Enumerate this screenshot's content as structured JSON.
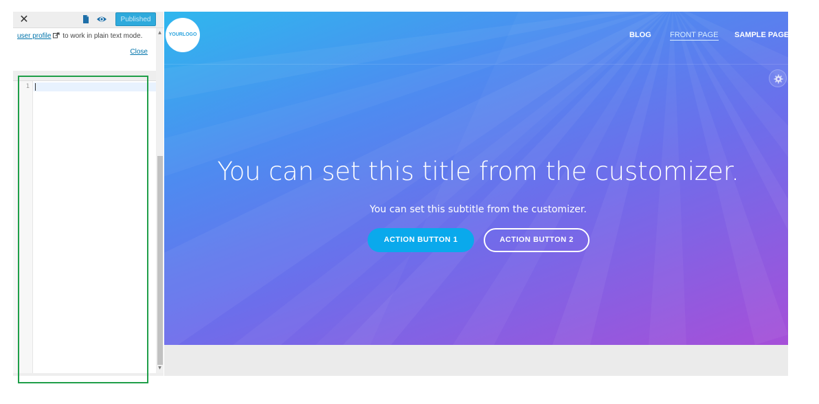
{
  "sidebar": {
    "close_icon": "close-icon",
    "doc_icon": "document-icon",
    "eye_icon": "eye-icon",
    "publish_label": "Published",
    "notice": {
      "link_text": "user profile",
      "link_icon": "external-link-icon",
      "text": "to work in plain text mode.",
      "close_label": "Close"
    },
    "editor": {
      "line_number": "1"
    }
  },
  "preview": {
    "logo_text": "YOURLOGO",
    "nav": {
      "blog": "BLOG",
      "front_page": "FRONT PAGE",
      "sample_page": "SAMPLE PAGE"
    },
    "gear_icon": "gear-icon",
    "hero": {
      "title": "You can set this title from the customizer.",
      "subtitle": "You can set this subtitle from the customizer.",
      "button1": "ACTION BUTTON 1",
      "button2": "ACTION BUTTON 2"
    }
  },
  "colors": {
    "publish_blue": "#2eaadc",
    "link_blue": "#0073aa",
    "highlight_green": "#1e9e48",
    "primary_button": "#0aa9ec",
    "gradient_start": "#2fb7ee",
    "gradient_end": "#a64fd8"
  }
}
